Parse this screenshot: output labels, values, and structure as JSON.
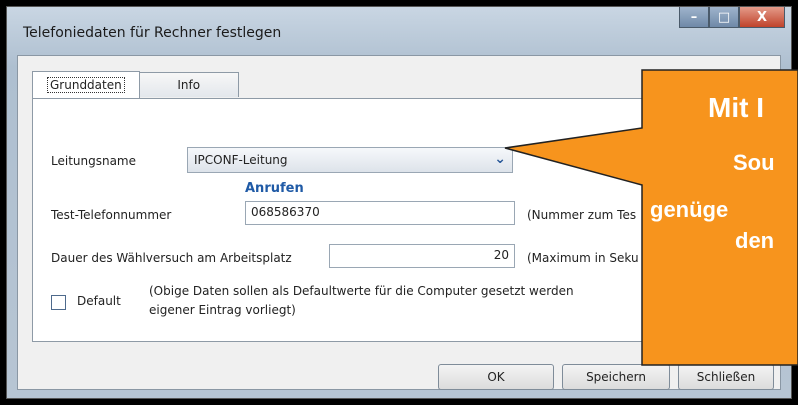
{
  "window": {
    "title": "Telefoniedaten für Rechner festlegen",
    "minimize_glyph": "–",
    "maximize_glyph": "□",
    "close_glyph": "X"
  },
  "tabs": [
    {
      "label": "Grunddaten",
      "active": true
    },
    {
      "label": "Info",
      "active": false
    }
  ],
  "form": {
    "line_name_label": "Leitungsname",
    "line_name_value": "IPCONF-Leitung",
    "call_link": "Anrufen",
    "test_phone_label": "Test-Telefonnummer",
    "test_phone_value": "068586370",
    "test_phone_hint": "(Nummer zum Tes",
    "dial_duration_label": "Dauer des Wählversuch am Arbeitsplatz",
    "dial_duration_value": "20",
    "dial_duration_hint": "(Maximum in Seku",
    "default_label": "Default",
    "default_checked": false,
    "default_note_line1": "(Obige Daten sollen als Defaultwerte für die Computer gesetzt werden",
    "default_note_line2": "eigener Eintrag vorliegt)"
  },
  "buttons": {
    "ok": "OK",
    "save": "Speichern",
    "close": "Schließen"
  },
  "callout": {
    "line1": "Mit I",
    "line2": "Sou",
    "line3": "genüge",
    "line4": "den",
    "fill_color": "#f7941d"
  }
}
